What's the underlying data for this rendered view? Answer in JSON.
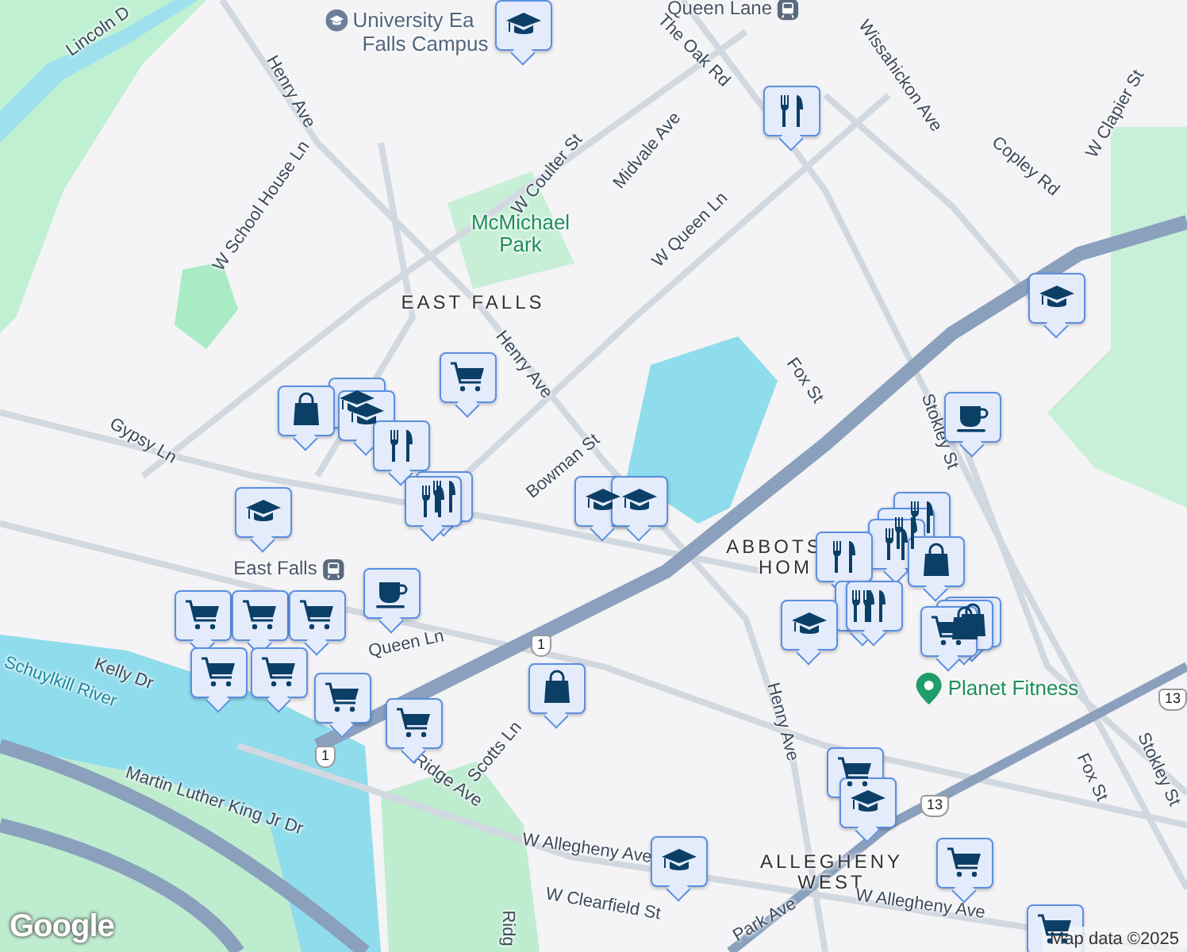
{
  "map": {
    "labels": [
      {
        "kind": "street",
        "text": "Lincoln D"
      },
      {
        "kind": "poi",
        "text": "University Ea"
      },
      {
        "kind": "poi-text",
        "text": "Falls Campus"
      },
      {
        "kind": "transit",
        "text": "Queen Lane"
      },
      {
        "kind": "street",
        "text": "The Oak Rd"
      },
      {
        "kind": "street",
        "text": "Henry Ave"
      },
      {
        "kind": "street",
        "text": "W School House Ln"
      },
      {
        "kind": "street",
        "text": "W Coulter St"
      },
      {
        "kind": "park",
        "text": "McMichael Park"
      },
      {
        "kind": "street",
        "text": "Midvale Ave"
      },
      {
        "kind": "street",
        "text": "W Queen Ln"
      },
      {
        "kind": "street",
        "text": "Wissahickon Ave"
      },
      {
        "kind": "street",
        "text": "Copley Rd"
      },
      {
        "kind": "street",
        "text": "W Clapier St"
      },
      {
        "kind": "area",
        "text": "EAST FALLS"
      },
      {
        "kind": "street",
        "text": "Henry Ave"
      },
      {
        "kind": "street",
        "text": "Fox St"
      },
      {
        "kind": "street",
        "text": "Stokley St"
      },
      {
        "kind": "street",
        "text": "Gypsy Ln"
      },
      {
        "kind": "street",
        "text": "Bowman St"
      },
      {
        "kind": "transit",
        "text": "East Falls"
      },
      {
        "kind": "water",
        "text": "Schuylkill River"
      },
      {
        "kind": "street",
        "text": "Kelly Dr"
      },
      {
        "kind": "street",
        "text": "Queen Ln"
      },
      {
        "kind": "street",
        "text": "Ridge Ave"
      },
      {
        "kind": "street",
        "text": "Scotts Ln"
      },
      {
        "kind": "street",
        "text": "Martin Luther King Jr Dr"
      },
      {
        "kind": "street",
        "text": "W Allegheny Ave"
      },
      {
        "kind": "street",
        "text": "W Clearfield St"
      },
      {
        "kind": "street",
        "text": "Ridg"
      },
      {
        "kind": "area",
        "text": "ABBOTS"
      },
      {
        "kind": "area",
        "text": "HOM"
      },
      {
        "kind": "place",
        "text": "Planet Fitness"
      },
      {
        "kind": "street",
        "text": "Henry Ave"
      },
      {
        "kind": "street",
        "text": "Fox St"
      },
      {
        "kind": "street",
        "text": "Stokley St"
      },
      {
        "kind": "area",
        "text": "ALLEGHENY WEST"
      },
      {
        "kind": "street",
        "text": "W Allegheny Ave"
      },
      {
        "kind": "street",
        "text": "Park Ave"
      },
      {
        "kind": "shield",
        "text": "1"
      },
      {
        "kind": "shield",
        "text": "1"
      },
      {
        "kind": "shield",
        "text": "13"
      },
      {
        "kind": "shield",
        "text": "13"
      }
    ],
    "pins": [
      {
        "kind": "education"
      },
      {
        "kind": "restaurant"
      },
      {
        "kind": "education"
      },
      {
        "kind": "cafe"
      },
      {
        "kind": "grocery"
      },
      {
        "kind": "education"
      },
      {
        "kind": "shopping"
      },
      {
        "kind": "education"
      },
      {
        "kind": "restaurant"
      },
      {
        "kind": "restaurant"
      },
      {
        "kind": "restaurant"
      },
      {
        "kind": "education"
      },
      {
        "kind": "education"
      },
      {
        "kind": "education"
      },
      {
        "kind": "cafe"
      },
      {
        "kind": "grocery"
      },
      {
        "kind": "grocery"
      },
      {
        "kind": "grocery"
      },
      {
        "kind": "grocery"
      },
      {
        "kind": "grocery"
      },
      {
        "kind": "grocery"
      },
      {
        "kind": "grocery"
      },
      {
        "kind": "shopping"
      },
      {
        "kind": "restaurant"
      },
      {
        "kind": "restaurant"
      },
      {
        "kind": "restaurant"
      },
      {
        "kind": "restaurant"
      },
      {
        "kind": "shopping"
      },
      {
        "kind": "restaurant"
      },
      {
        "kind": "restaurant"
      },
      {
        "kind": "education"
      },
      {
        "kind": "shopping"
      },
      {
        "kind": "shopping"
      },
      {
        "kind": "grocery"
      },
      {
        "kind": "grocery"
      },
      {
        "kind": "education"
      },
      {
        "kind": "education"
      },
      {
        "kind": "grocery"
      },
      {
        "kind": "grocery"
      }
    ]
  },
  "attribution": {
    "logo": "Google",
    "text": "Map data ©2025"
  }
}
